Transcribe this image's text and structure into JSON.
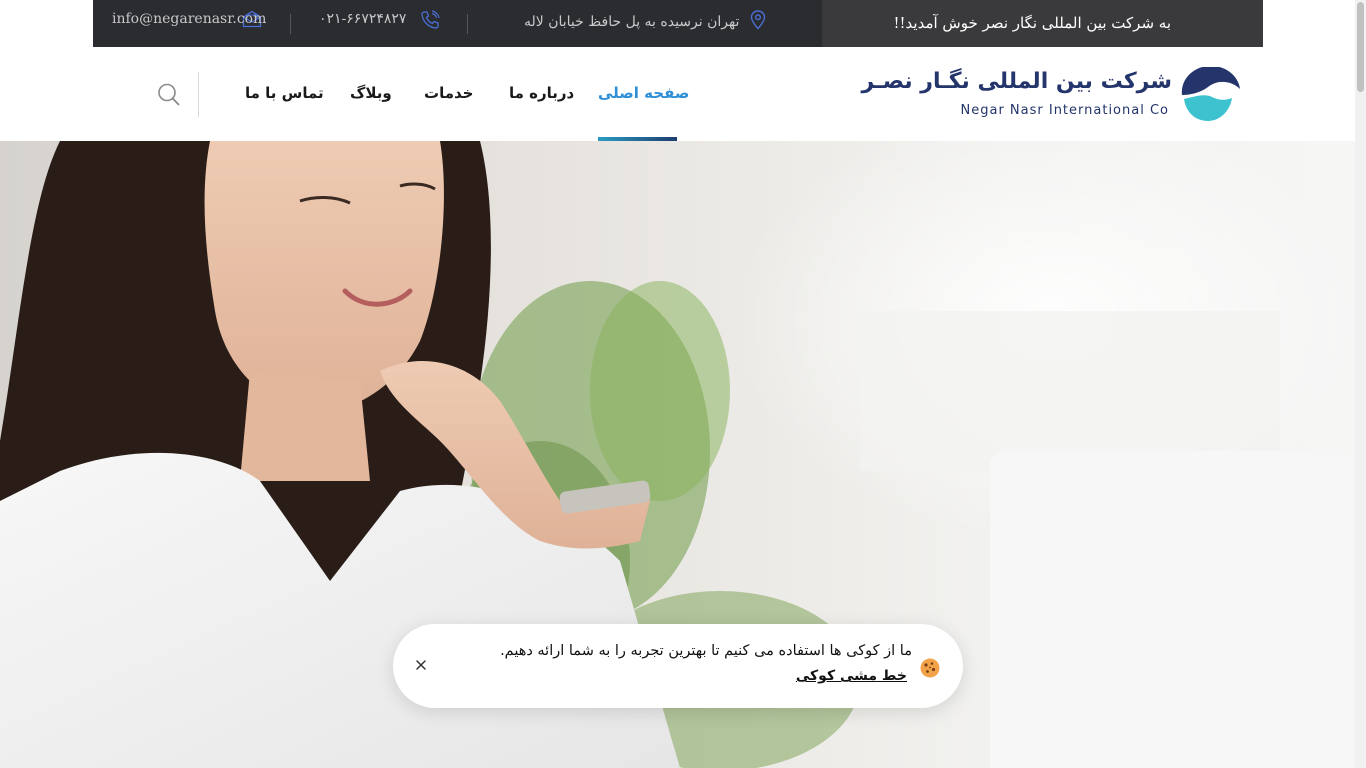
{
  "topbar": {
    "welcome": "به شرکت بین المللی نگار نصر خوش آمدید!!",
    "address": "تهران نرسیده به پل حافظ خیابان لاله",
    "phone": "۰۲۱-۶۶۷۲۴۸۲۷",
    "email": "info@negarenasr.com"
  },
  "logo": {
    "name_fa": "شرکت بین المللی نگـار نصـر",
    "name_en": "Negar Nasr International Co"
  },
  "nav": {
    "items": [
      {
        "label": "صفحه اصلی",
        "active": true
      },
      {
        "label": "درباره ما",
        "active": false
      },
      {
        "label": "خدمات",
        "active": false
      },
      {
        "label": "وبلاگ",
        "active": false
      },
      {
        "label": "تماس با ما",
        "active": false
      }
    ]
  },
  "cookie": {
    "message": "ما از کوکی ها استفاده می کنیم تا بهترین تجربه را به شما ارائه دهیم.",
    "policy_link": "خط مشی کوکی"
  },
  "colors": {
    "topbar_bg": "#2b2c30",
    "accent_blue": "#2f8fd6",
    "logo_navy": "#23356b",
    "logo_teal": "#3cc3cf",
    "icon_blue": "#4a6fd6"
  },
  "icons": [
    "location-icon",
    "phone-icon",
    "email-icon",
    "search-icon",
    "cookie-icon",
    "close-icon",
    "logo-mark-icon"
  ]
}
